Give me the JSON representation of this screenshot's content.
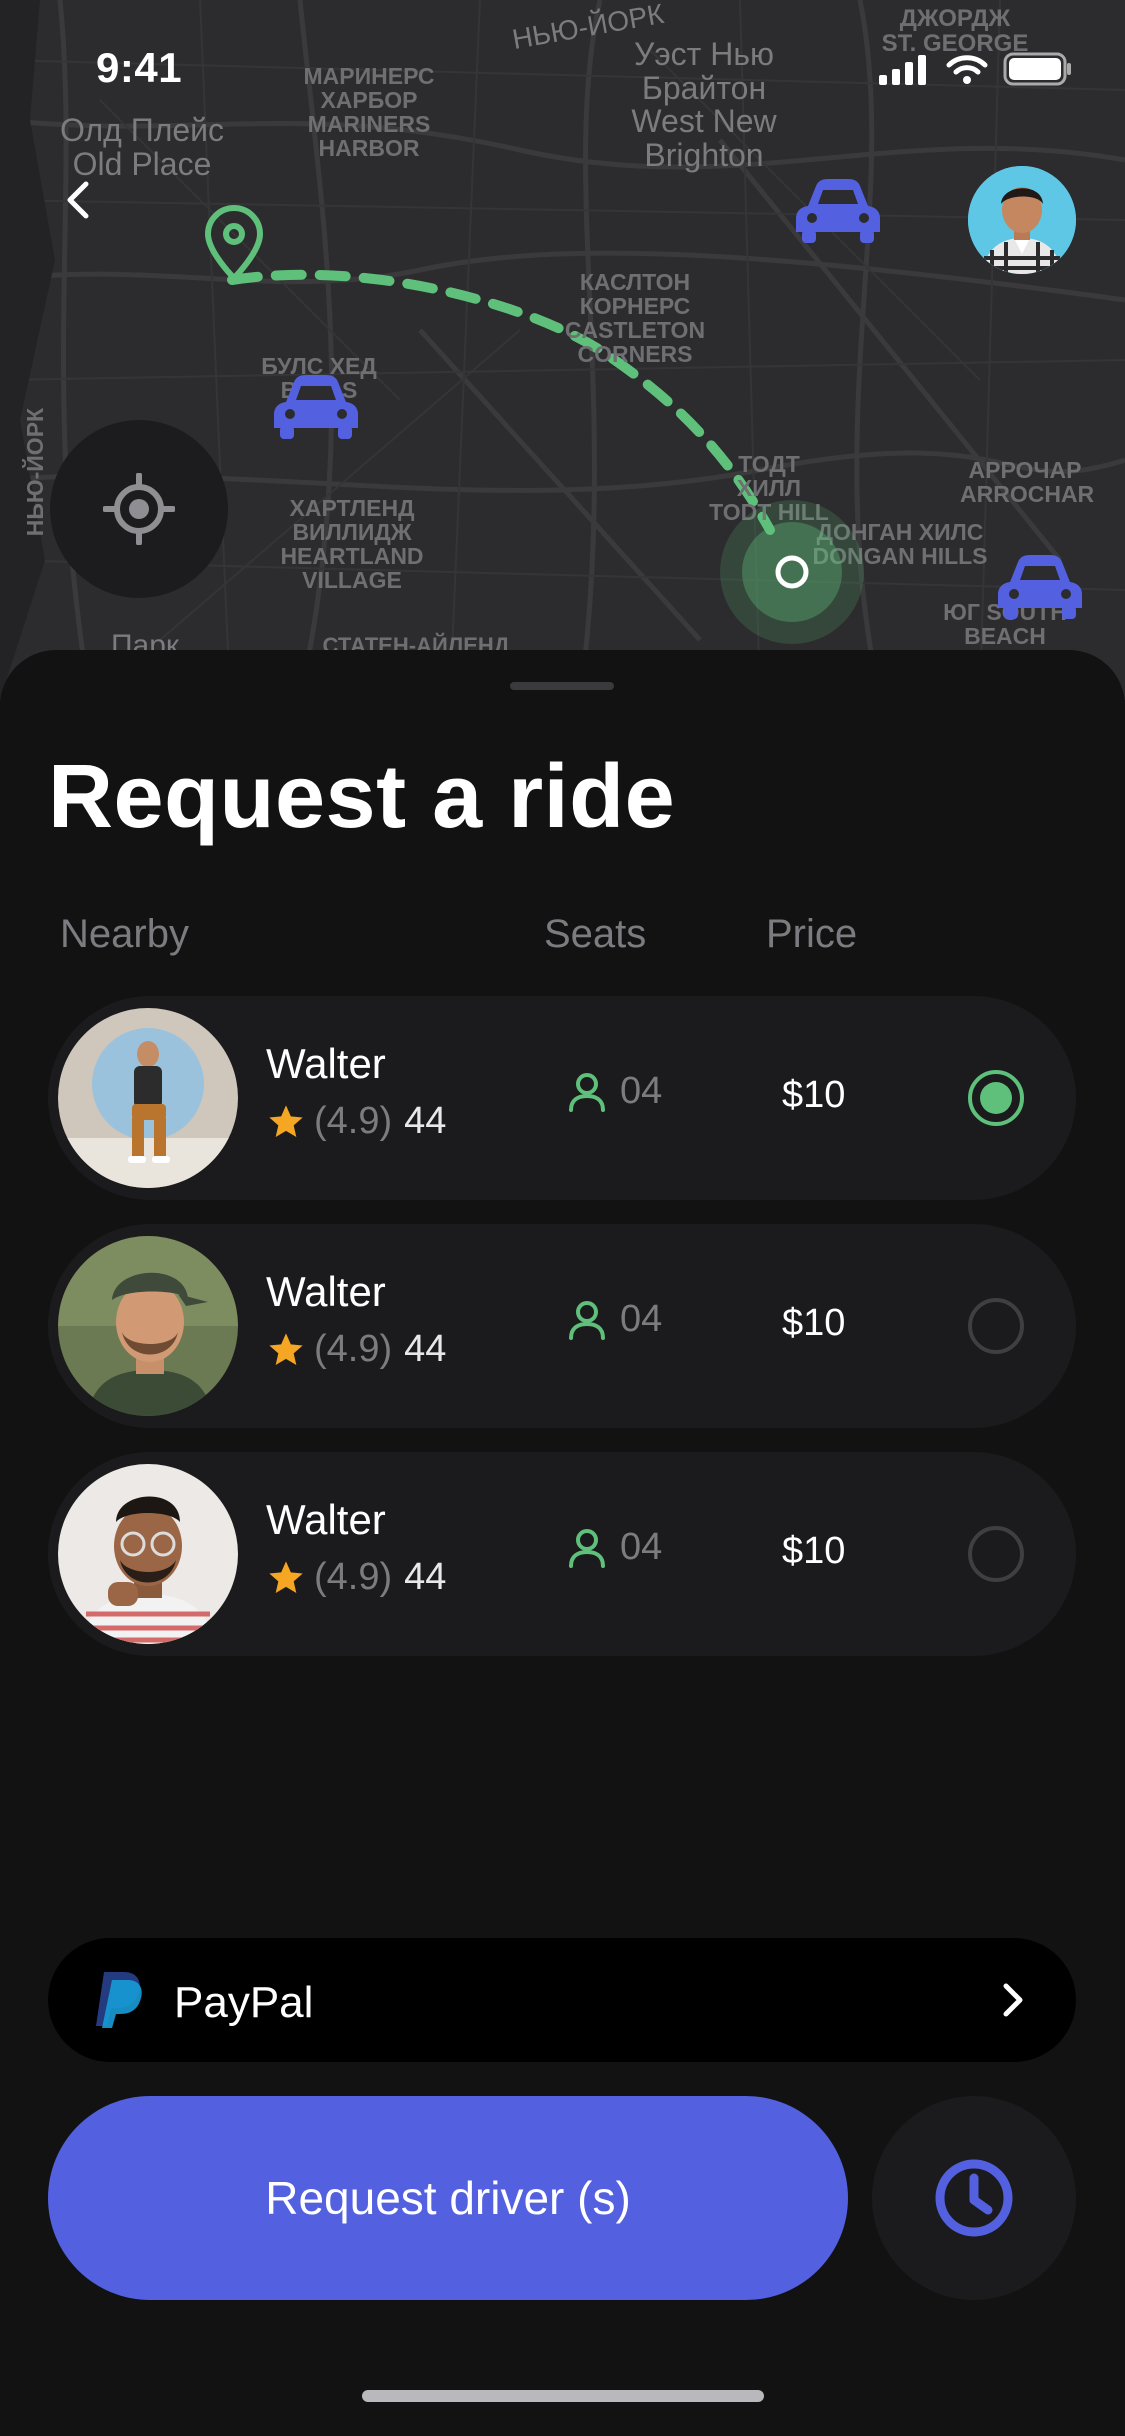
{
  "status_bar": {
    "time": "9:41"
  },
  "map": {
    "labels": [
      {
        "text": "НЬЮ-ЙОРК"
      },
      {
        "text": "МАРИНЕРС ХАРБОР MARINERS HARBOR"
      },
      {
        "text": "Олд Плейс Old Place"
      },
      {
        "text": "Уэст Нью Брайтон West New Brighton"
      },
      {
        "text": "ДЖОРДЖ ST. GEORGE"
      },
      {
        "text": "КАСЛТОН КОРНЕРС CASTLETON CORNERS"
      },
      {
        "text": "БУЛС ХЕД BULLS HEAD"
      },
      {
        "text": "ТОДТ ХИЛЛ TODT HILL"
      },
      {
        "text": "АРРОЧАР ARROCHAR"
      },
      {
        "text": "ХАРТЛЕНД ВИЛЛИДЖ HEARTLAND VILLAGE"
      },
      {
        "text": "ДОНГАН ХИЛС DONGAN HILLS"
      },
      {
        "text": "ЮГ SOUTH BEACH"
      },
      {
        "text": "НЬЮ-ЙОРК"
      },
      {
        "text": "Парк"
      },
      {
        "text": "СТАТЕН-АЙЛЕНД"
      }
    ],
    "route_color": "#5ec07a",
    "car_color": "#5360e0"
  },
  "sheet": {
    "title": "Request a ride",
    "columns": {
      "nearby": "Nearby",
      "seats": "Seats",
      "price": "Price"
    }
  },
  "drivers": [
    {
      "name": "Walter",
      "rating": "(4.9)",
      "reviews": "44",
      "seats": "04",
      "price": "$10",
      "selected": true
    },
    {
      "name": "Walter",
      "rating": "(4.9)",
      "reviews": "44",
      "seats": "04",
      "price": "$10",
      "selected": false
    },
    {
      "name": "Walter",
      "rating": "(4.9)",
      "reviews": "44",
      "seats": "04",
      "price": "$10",
      "selected": false
    }
  ],
  "payment": {
    "method": "PayPal"
  },
  "actions": {
    "request_label": "Request driver (s)"
  },
  "colors": {
    "accent": "#5360e0",
    "success": "#5ec07a",
    "star": "#f5a623",
    "background": "#121212"
  },
  "icons": [
    "back-icon",
    "car-icon",
    "location-pin-icon",
    "locate-icon",
    "person-icon",
    "star-icon",
    "paypal-icon",
    "chevron-right-icon",
    "clock-icon"
  ]
}
